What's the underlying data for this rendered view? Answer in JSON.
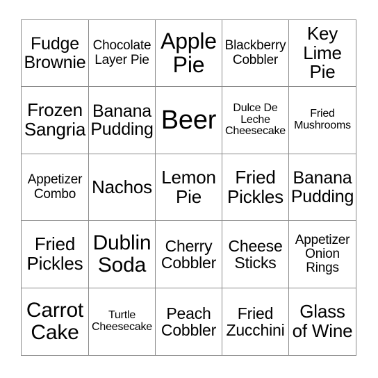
{
  "card": {
    "columns": 5,
    "rows": 5,
    "border_color": "#8a8a8a",
    "background_color": "#ffffff",
    "text_color": "#000000",
    "cells": [
      {
        "text": "Fudge Brownie",
        "size": "md"
      },
      {
        "text": "Chocolate Layer Pie",
        "size": "xs"
      },
      {
        "text": "Apple Pie",
        "size": "xl"
      },
      {
        "text": "Blackberry Cobbler",
        "size": "xs"
      },
      {
        "text": "Key Lime Pie",
        "size": "md"
      },
      {
        "text": "Frozen Sangria",
        "size": "md"
      },
      {
        "text": "Banana Pudding",
        "size": "md"
      },
      {
        "text": "Beer",
        "size": "xxl"
      },
      {
        "text": "Dulce De Leche Cheesecake",
        "size": "xxs"
      },
      {
        "text": "Fried Mushrooms",
        "size": "xxs"
      },
      {
        "text": "Appetizer Combo",
        "size": "xs"
      },
      {
        "text": "Nachos",
        "size": "md"
      },
      {
        "text": "Lemon Pie",
        "size": "md"
      },
      {
        "text": "Fried Pickles",
        "size": "md"
      },
      {
        "text": "Banana Pudding",
        "size": "md"
      },
      {
        "text": "Fried Pickles",
        "size": "md"
      },
      {
        "text": "Dublin Soda",
        "size": "lg"
      },
      {
        "text": "Cherry Cobbler",
        "size": "sm"
      },
      {
        "text": "Cheese Sticks",
        "size": "sm"
      },
      {
        "text": "Appetizer Onion Rings",
        "size": "xs"
      },
      {
        "text": "Carrot Cake",
        "size": "lg"
      },
      {
        "text": "Turtle Cheesecake",
        "size": "xs"
      },
      {
        "text": "Peach Cobbler",
        "size": "sm"
      },
      {
        "text": "Fried Zucchini",
        "size": "sm"
      },
      {
        "text": "Glass of Wine",
        "size": "md"
      }
    ]
  }
}
